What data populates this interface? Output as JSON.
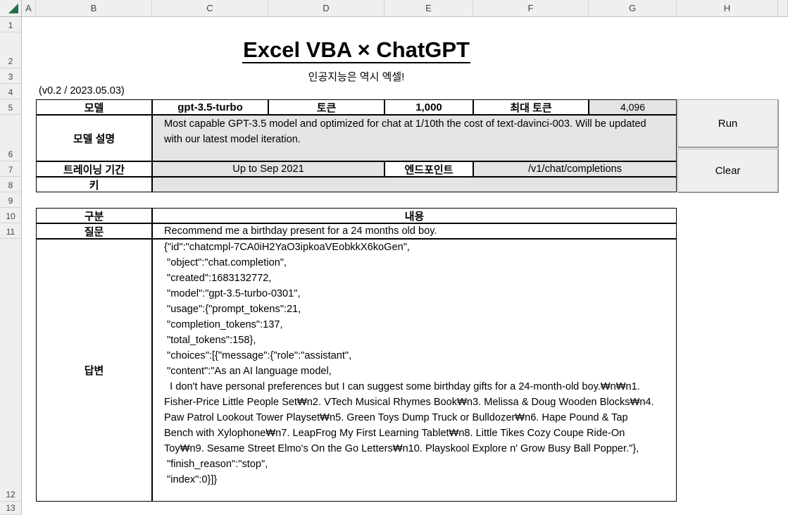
{
  "sheet": {
    "columns": [
      "A",
      "B",
      "C",
      "D",
      "E",
      "F",
      "G",
      "H"
    ],
    "rows": [
      "1",
      "2",
      "3",
      "4",
      "5",
      "6",
      "7",
      "8",
      "9",
      "10",
      "11",
      "12",
      "13"
    ]
  },
  "title": "Excel VBA × ChatGPT",
  "subtitle": "인공지능은 역시 엑셀!",
  "version": "(v0.2 / 2023.05.03)",
  "settings": {
    "model_label": "모델",
    "model_value": "gpt-3.5-turbo",
    "token_label": "토큰",
    "token_value": "1,000",
    "max_token_label": "최대 토큰",
    "max_token_value": "4,096",
    "desc_label": "모델 설명",
    "desc_value": "Most capable GPT-3.5 model and optimized for chat at 1/10th the cost of text-davinci-003. Will be updated with our latest model iteration.",
    "training_label": "트레이닝 기간",
    "training_value": "Up to Sep 2021",
    "endpoint_label": "엔드포인트",
    "endpoint_value": "/v1/chat/completions",
    "key_label": "키",
    "key_value": ""
  },
  "buttons": {
    "run": "Run",
    "clear": "Clear"
  },
  "qa": {
    "header_category": "구분",
    "header_content": "내용",
    "question_label": "질문",
    "question": "Recommend me a birthday present for a 24 months old boy.",
    "answer_label": "답변",
    "answer_lines": [
      "{\"id\":\"chatcmpl-7CA0iH2YaO3ipkoaVEobkkX6koGen\",",
      " \"object\":\"chat.completion\",",
      " \"created\":1683132772,",
      " \"model\":\"gpt-3.5-turbo-0301\",",
      " \"usage\":{\"prompt_tokens\":21,",
      " \"completion_tokens\":137,",
      " \"total_tokens\":158},",
      " \"choices\":[{\"message\":{\"role\":\"assistant\",",
      " \"content\":\"As an AI language model,",
      "  I don't have personal preferences but I can suggest some birthday gifts for a 24-month-old boy.₩n₩n1.",
      "Fisher-Price Little People Set₩n2. VTech Musical Rhymes Book₩n3. Melissa & Doug Wooden Blocks₩n4.",
      "Paw Patrol Lookout Tower Playset₩n5. Green Toys Dump Truck or Bulldozer₩n6. Hape Pound & Tap",
      "Bench with Xylophone₩n7. LeapFrog My First Learning Tablet₩n8. Little Tikes Cozy Coupe Ride-On",
      "Toy₩n9. Sesame Street Elmo's On the Go Letters₩n10. Playskool Explore n' Grow Busy Ball Popper.\"},",
      " \"finish_reason\":\"stop\",",
      " \"index\":0}]}"
    ]
  }
}
